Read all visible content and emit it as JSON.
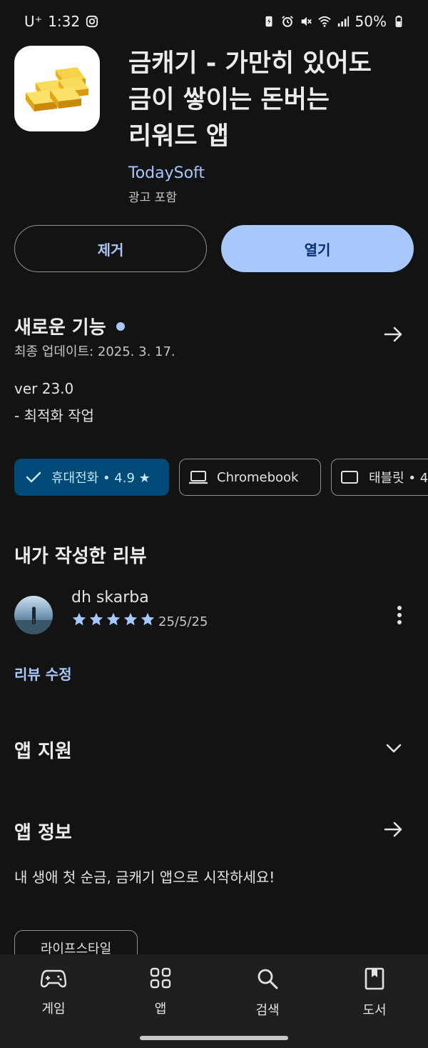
{
  "status_bar": {
    "carrier": "U⁺",
    "time": "1:32",
    "battery": "50%"
  },
  "app": {
    "title_line1": "금캐기 - 가만히 있어도",
    "title_line2": "금이 쌓이는 돈버는",
    "title_line3": "리워드 앱",
    "developer": "TodaySoft",
    "ads_notice": "광고 포함",
    "icon": "gold-bars-icon"
  },
  "actions": {
    "remove_label": "제거",
    "open_label": "열기"
  },
  "whats_new": {
    "title": "새로운 기능",
    "last_updated": "최종 업데이트: 2025. 3. 17.",
    "version": "ver 23.0",
    "note": "- 최적화 작업"
  },
  "devices": {
    "phone": "휴대전화 • 4.9 ★",
    "chromebook": "Chromebook",
    "tablet": "태블릿 • 4"
  },
  "my_review": {
    "title": "내가 작성한 리뷰",
    "author": "dh skarba",
    "stars": 5,
    "date": "25/5/25",
    "edit_label": "리뷰 수정"
  },
  "app_support": {
    "title": "앱 지원"
  },
  "app_info": {
    "title": "앱 정보",
    "description": "내 생애 첫 순금, 금캐기 앱으로 시작하세요!",
    "tag": "라이프스타일"
  },
  "bottom_nav": {
    "games": "게임",
    "apps": "앱",
    "search": "검색",
    "books": "도서"
  },
  "colors": {
    "background": "#131314",
    "accent": "#a8c7fa",
    "chip_selected": "#004a77",
    "nav_background": "#1e1f20"
  }
}
